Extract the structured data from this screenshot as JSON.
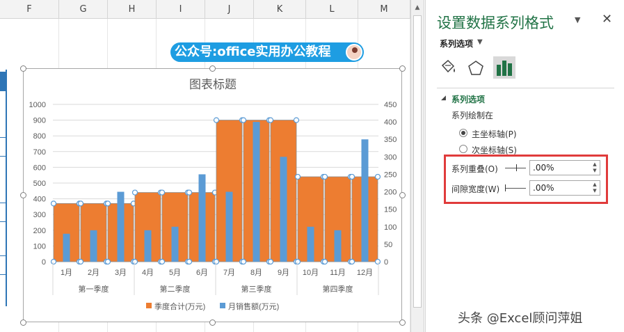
{
  "spreadsheet": {
    "columns": [
      "F",
      "G",
      "H",
      "I",
      "J",
      "K",
      "L",
      "M"
    ]
  },
  "watermark": {
    "text": "公众号:office实用办公教程"
  },
  "attribution": {
    "text": "头条 @Excel顾问萍姐"
  },
  "format_pane": {
    "title": "设置数据系列格式",
    "options_menu": "系列选项",
    "section_header": "系列选项",
    "plot_on_label": "系列绘制在",
    "primary_axis": "主坐标轴(P)",
    "secondary_axis": "次坐标轴(S)",
    "overlap_label": "系列重叠(O)",
    "overlap_value": ".00%",
    "gap_label": "间隙宽度(W)",
    "gap_value": ".00%",
    "primary_selected": true
  },
  "colors": {
    "orange": "#ed7d31",
    "blue": "#5b9bd5",
    "excel_green": "#217346",
    "highlight_red": "#e03b3b"
  },
  "chart_data": {
    "type": "bar",
    "title": "图表标题",
    "categories": [
      "1月",
      "2月",
      "3月",
      "4月",
      "5月",
      "6月",
      "7月",
      "8月",
      "9月",
      "10月",
      "11月",
      "12月"
    ],
    "groups": [
      "第一季度",
      "第二季度",
      "第三季度",
      "第四季度"
    ],
    "series": [
      {
        "name": "季度合计(万元)",
        "axis": "primary",
        "values": [
          370,
          370,
          370,
          440,
          440,
          440,
          900,
          900,
          900,
          540,
          540,
          540
        ]
      },
      {
        "name": "月销售额(万元)",
        "axis": "secondary",
        "values": [
          80,
          90,
          200,
          90,
          100,
          250,
          200,
          400,
          300,
          100,
          90,
          350
        ]
      }
    ],
    "y_left": {
      "min": 0,
      "max": 1000,
      "ticks": [
        0,
        100,
        200,
        300,
        400,
        500,
        600,
        700,
        800,
        900,
        1000
      ]
    },
    "y_right": {
      "min": 0,
      "max": 450,
      "ticks": [
        0,
        50,
        100,
        150,
        200,
        250,
        300,
        350,
        400,
        450
      ]
    },
    "grid": true,
    "legend": "bottom"
  }
}
